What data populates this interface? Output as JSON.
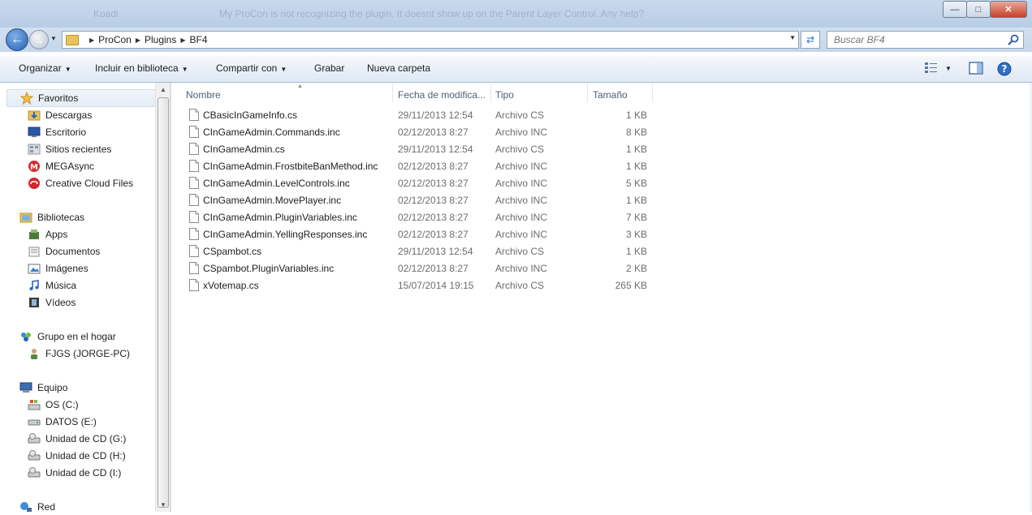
{
  "window": {
    "ghost_title": "My ProCon is not recognizing the plugin. It doesnt show up on the Parent Layer Control. Any help?",
    "ghost_left": "Koadi",
    "buttons": [
      "minimize",
      "maximize",
      "close"
    ]
  },
  "address_bar": {
    "breadcrumbs": [
      "ProCon",
      "Plugins",
      "BF4"
    ],
    "search_placeholder": "Buscar BF4"
  },
  "toolbar": {
    "organize": "Organizar",
    "include_library": "Incluir en biblioteca",
    "share_with": "Compartir con",
    "burn": "Grabar",
    "new_folder": "Nueva carpeta"
  },
  "nav": {
    "favorites": {
      "label": "Favoritos",
      "items": [
        "Descargas",
        "Escritorio",
        "Sitios recientes",
        "MEGAsync",
        "Creative Cloud Files"
      ]
    },
    "libraries": {
      "label": "Bibliotecas",
      "items": [
        "Apps",
        "Documentos",
        "Imágenes",
        "Música",
        "Vídeos"
      ]
    },
    "homegroup": {
      "label": "Grupo en el hogar",
      "items": [
        "FJGS (JORGE-PC)"
      ]
    },
    "computer": {
      "label": "Equipo",
      "items": [
        "OS (C:)",
        "DATOS (E:)",
        "Unidad de CD (G:)",
        "Unidad de CD (H:)",
        "Unidad de CD (I:)"
      ]
    },
    "network": {
      "label": "Red"
    }
  },
  "columns": {
    "name": "Nombre",
    "date": "Fecha de modifica...",
    "type": "Tipo",
    "size": "Tamaño"
  },
  "files": [
    {
      "name": "CBasicInGameInfo.cs",
      "date": "29/11/2013 12:54",
      "type": "Archivo CS",
      "size": "1 KB"
    },
    {
      "name": "CInGameAdmin.Commands.inc",
      "date": "02/12/2013 8:27",
      "type": "Archivo INC",
      "size": "8 KB"
    },
    {
      "name": "CInGameAdmin.cs",
      "date": "29/11/2013 12:54",
      "type": "Archivo CS",
      "size": "1 KB"
    },
    {
      "name": "CInGameAdmin.FrostbiteBanMethod.inc",
      "date": "02/12/2013 8:27",
      "type": "Archivo INC",
      "size": "1 KB"
    },
    {
      "name": "CInGameAdmin.LevelControls.inc",
      "date": "02/12/2013 8:27",
      "type": "Archivo INC",
      "size": "5 KB"
    },
    {
      "name": "CInGameAdmin.MovePlayer.inc",
      "date": "02/12/2013 8:27",
      "type": "Archivo INC",
      "size": "1 KB"
    },
    {
      "name": "CInGameAdmin.PluginVariables.inc",
      "date": "02/12/2013 8:27",
      "type": "Archivo INC",
      "size": "7 KB"
    },
    {
      "name": "CInGameAdmin.YellingResponses.inc",
      "date": "02/12/2013 8:27",
      "type": "Archivo INC",
      "size": "3 KB"
    },
    {
      "name": "CSpambot.cs",
      "date": "29/11/2013 12:54",
      "type": "Archivo CS",
      "size": "1 KB"
    },
    {
      "name": "CSpambot.PluginVariables.inc",
      "date": "02/12/2013 8:27",
      "type": "Archivo INC",
      "size": "2 KB"
    },
    {
      "name": "xVotemap.cs",
      "date": "15/07/2014 19:15",
      "type": "Archivo CS",
      "size": "265 KB"
    }
  ]
}
